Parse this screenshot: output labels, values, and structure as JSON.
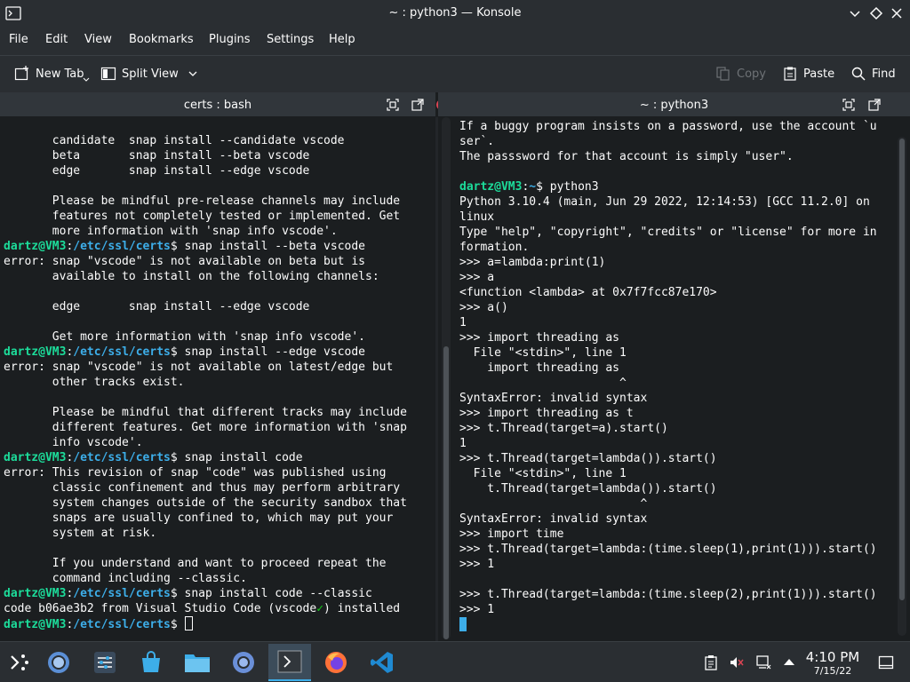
{
  "window": {
    "title": "~ : python3 — Konsole"
  },
  "menu": [
    "File",
    "Edit",
    "View",
    "Bookmarks",
    "Plugins",
    "Settings",
    "Help"
  ],
  "toolbar": {
    "new_tab": "New Tab",
    "split_view": "Split View",
    "copy": "Copy",
    "paste": "Paste",
    "find": "Find"
  },
  "left_pane": {
    "title": "certs : bash",
    "lines": [
      [
        {
          "t": "       candidate  snap install --candidate vscode"
        }
      ],
      [
        {
          "t": "       beta       snap install --beta vscode"
        }
      ],
      [
        {
          "t": "       edge       snap install --edge vscode"
        }
      ],
      [
        {
          "t": ""
        }
      ],
      [
        {
          "t": "       Please be mindful pre-release channels may include"
        }
      ],
      [
        {
          "t": "       features not completely tested or implemented. Get"
        }
      ],
      [
        {
          "t": "       more information with 'snap info vscode'."
        }
      ],
      [
        {
          "t": "dartz@VM3",
          "c": "g"
        },
        {
          "t": ":"
        },
        {
          "t": "/etc/ssl/certs",
          "c": "b"
        },
        {
          "t": "$ snap install --beta vscode"
        }
      ],
      [
        {
          "t": "error: snap \"vscode\" is not available on beta but is"
        }
      ],
      [
        {
          "t": "       available to install on the following channels:"
        }
      ],
      [
        {
          "t": ""
        }
      ],
      [
        {
          "t": "       edge       snap install --edge vscode"
        }
      ],
      [
        {
          "t": ""
        }
      ],
      [
        {
          "t": "       Get more information with 'snap info vscode'."
        }
      ],
      [
        {
          "t": "dartz@VM3",
          "c": "g"
        },
        {
          "t": ":"
        },
        {
          "t": "/etc/ssl/certs",
          "c": "b"
        },
        {
          "t": "$ snap install --edge vscode"
        }
      ],
      [
        {
          "t": "error: snap \"vscode\" is not available on latest/edge but"
        }
      ],
      [
        {
          "t": "       other tracks exist."
        }
      ],
      [
        {
          "t": ""
        }
      ],
      [
        {
          "t": "       Please be mindful that different tracks may include"
        }
      ],
      [
        {
          "t": "       different features. Get more information with 'snap"
        }
      ],
      [
        {
          "t": "       info vscode'."
        }
      ],
      [
        {
          "t": "dartz@VM3",
          "c": "g"
        },
        {
          "t": ":"
        },
        {
          "t": "/etc/ssl/certs",
          "c": "b"
        },
        {
          "t": "$ snap install code"
        }
      ],
      [
        {
          "t": "error: This revision of snap \"code\" was published using"
        }
      ],
      [
        {
          "t": "       classic confinement and thus may perform arbitrary"
        }
      ],
      [
        {
          "t": "       system changes outside of the security sandbox that"
        }
      ],
      [
        {
          "t": "       snaps are usually confined to, which may put your"
        }
      ],
      [
        {
          "t": "       system at risk."
        }
      ],
      [
        {
          "t": ""
        }
      ],
      [
        {
          "t": "       If you understand and want to proceed repeat the"
        }
      ],
      [
        {
          "t": "       command including --classic."
        }
      ],
      [
        {
          "t": "dartz@VM3",
          "c": "g"
        },
        {
          "t": ":"
        },
        {
          "t": "/etc/ssl/certs",
          "c": "b"
        },
        {
          "t": "$ snap install code --classic"
        }
      ],
      [
        {
          "t": "code b06ae3b2 from Visual Studio Code (vscode"
        },
        {
          "t": "✓",
          "c": "gr"
        },
        {
          "t": ") installed"
        }
      ],
      [
        {
          "t": "dartz@VM3",
          "c": "g"
        },
        {
          "t": ":"
        },
        {
          "t": "/etc/ssl/certs",
          "c": "b"
        },
        {
          "t": "$ "
        },
        {
          "cursor": "hollow"
        }
      ]
    ]
  },
  "right_pane": {
    "title": "~ : python3",
    "lines": [
      [
        {
          "t": "If a buggy program insists on a password, use the account `u"
        }
      ],
      [
        {
          "t": "ser`."
        }
      ],
      [
        {
          "t": "The passsword for that account is simply \"user\"."
        }
      ],
      [
        {
          "t": ""
        }
      ],
      [
        {
          "t": "dartz@VM3",
          "c": "g"
        },
        {
          "t": ":"
        },
        {
          "t": "~",
          "c": "b"
        },
        {
          "t": "$ python3"
        }
      ],
      [
        {
          "t": "Python 3.10.4 (main, Jun 29 2022, 12:14:53) [GCC 11.2.0] on"
        }
      ],
      [
        {
          "t": "linux"
        }
      ],
      [
        {
          "t": "Type \"help\", \"copyright\", \"credits\" or \"license\" for more in"
        }
      ],
      [
        {
          "t": "formation."
        }
      ],
      [
        {
          "t": ">>> a=lambda:print(1)"
        }
      ],
      [
        {
          "t": ">>> a"
        }
      ],
      [
        {
          "t": "<function <lambda> at 0x7f7fcc87e170>"
        }
      ],
      [
        {
          "t": ">>> a()"
        }
      ],
      [
        {
          "t": "1"
        }
      ],
      [
        {
          "t": ">>> import threading as"
        }
      ],
      [
        {
          "t": "  File \"<stdin>\", line 1"
        }
      ],
      [
        {
          "t": "    import threading as"
        }
      ],
      [
        {
          "t": "                       ^"
        }
      ],
      [
        {
          "t": "SyntaxError: invalid syntax"
        }
      ],
      [
        {
          "t": ">>> import threading as t"
        }
      ],
      [
        {
          "t": ">>> t.Thread(target=a).start()"
        }
      ],
      [
        {
          "t": "1"
        }
      ],
      [
        {
          "t": ">>> t.Thread(target=lambda()).start()"
        }
      ],
      [
        {
          "t": "  File \"<stdin>\", line 1"
        }
      ],
      [
        {
          "t": "    t.Thread(target=lambda()).start()"
        }
      ],
      [
        {
          "t": "                          ^"
        }
      ],
      [
        {
          "t": "SyntaxError: invalid syntax"
        }
      ],
      [
        {
          "t": ">>> import time"
        }
      ],
      [
        {
          "t": ">>> t.Thread(target=lambda:(time.sleep(1),print(1))).start()"
        }
      ],
      [
        {
          "t": ">>> 1"
        }
      ],
      [
        {
          "t": ""
        }
      ],
      [
        {
          "t": ">>> t.Thread(target=lambda:(time.sleep(2),print(1))).start()"
        }
      ],
      [
        {
          "t": ">>> 1"
        }
      ],
      [
        {
          "cursor": "filled"
        }
      ]
    ]
  },
  "taskbar": {
    "time": "4:10 PM",
    "date": "7/15/22"
  },
  "colors": {
    "prompt_user": "#1cdc9a",
    "prompt_path": "#3daee9",
    "accent": "#3daee9",
    "close_red": "#da4453"
  }
}
